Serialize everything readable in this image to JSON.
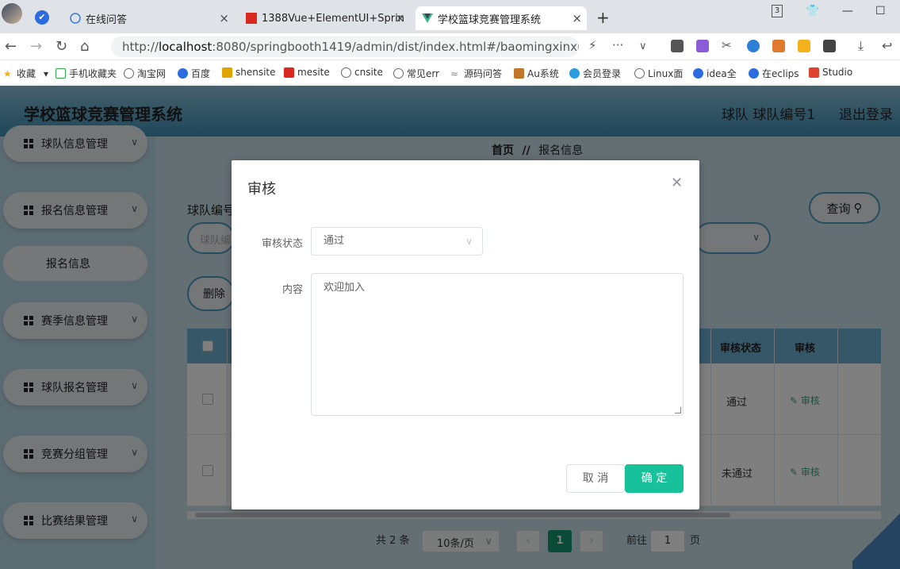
{
  "browser": {
    "tabs": [
      {
        "label": "在线问答"
      },
      {
        "label": "1388Vue+ElementUI+Sprin"
      },
      {
        "label": "学校篮球竞赛管理系统"
      }
    ],
    "window_counter": "3",
    "url_prefix": "http://",
    "url_host": "localhost",
    "url_rest": ":8080/springbooth1419/admin/dist/index.html#/baomingxinxi",
    "bookmarks": [
      "收藏",
      "手机收藏夹",
      "淘宝网",
      "百度",
      "shensite",
      "mesite",
      "cnsite",
      "常见err",
      "源码问答",
      "Au系统",
      "会员登录",
      "Linux面",
      "idea全",
      "在eclips",
      "Studio"
    ]
  },
  "app": {
    "title": "学校篮球竞赛管理系统",
    "user_info": "球队 球队编号1",
    "logout": "退出登录"
  },
  "sidebar": {
    "items": [
      {
        "label": "球队信息管理"
      },
      {
        "label": "报名信息管理"
      },
      {
        "label": "报名信息"
      },
      {
        "label": "赛季信息管理"
      },
      {
        "label": "球队报名管理"
      },
      {
        "label": "竞赛分组管理"
      },
      {
        "label": "比赛结果管理"
      }
    ]
  },
  "main": {
    "breadcrumb_home": "首页",
    "breadcrumb_sep": "//",
    "breadcrumb_current": "报名信息",
    "search_label": "球队编号",
    "search_placeholder": "球队编",
    "query_button": "查询",
    "delete_button": "删除",
    "table": {
      "columns": [
        "审核状态",
        "审核"
      ],
      "rows": [
        {
          "status": "通过",
          "action": "审核"
        },
        {
          "status": "未通过",
          "action": "审核"
        }
      ]
    },
    "pager": {
      "total": "共 2 条",
      "page_size": "10条/页",
      "current": "1",
      "goto_prefix": "前往",
      "goto_value": "1",
      "goto_suffix": "页"
    }
  },
  "dialog": {
    "title": "审核",
    "status_label": "审核状态",
    "status_value": "通过",
    "content_label": "内容",
    "content_value": "欢迎加入",
    "cancel": "取 消",
    "confirm": "确 定"
  }
}
